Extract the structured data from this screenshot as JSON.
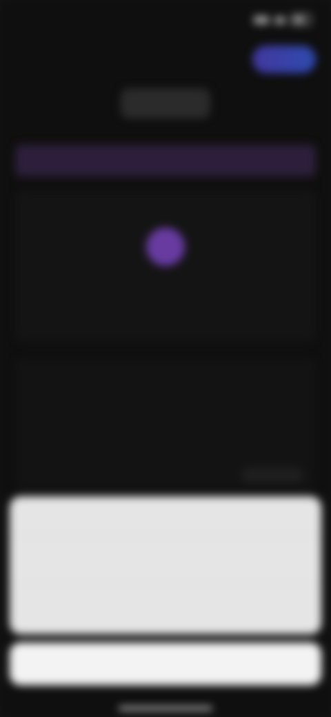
{
  "status_bar": {
    "time": ""
  },
  "header": {
    "title": "",
    "action_label": ""
  },
  "tabs": [
    {
      "label": "",
      "active": false
    },
    {
      "label": "",
      "active": true
    },
    {
      "label": "",
      "active": false
    }
  ],
  "banner": {
    "text": ""
  },
  "card": {
    "label": ""
  },
  "section": {
    "title": "",
    "description": ""
  },
  "action_sheet": {
    "title": "",
    "options": [
      "",
      ""
    ],
    "cancel_label": ""
  },
  "colors": {
    "accent_purple": "#8a4fd6",
    "link_blue": "#3d80d8",
    "background": "#141414"
  }
}
